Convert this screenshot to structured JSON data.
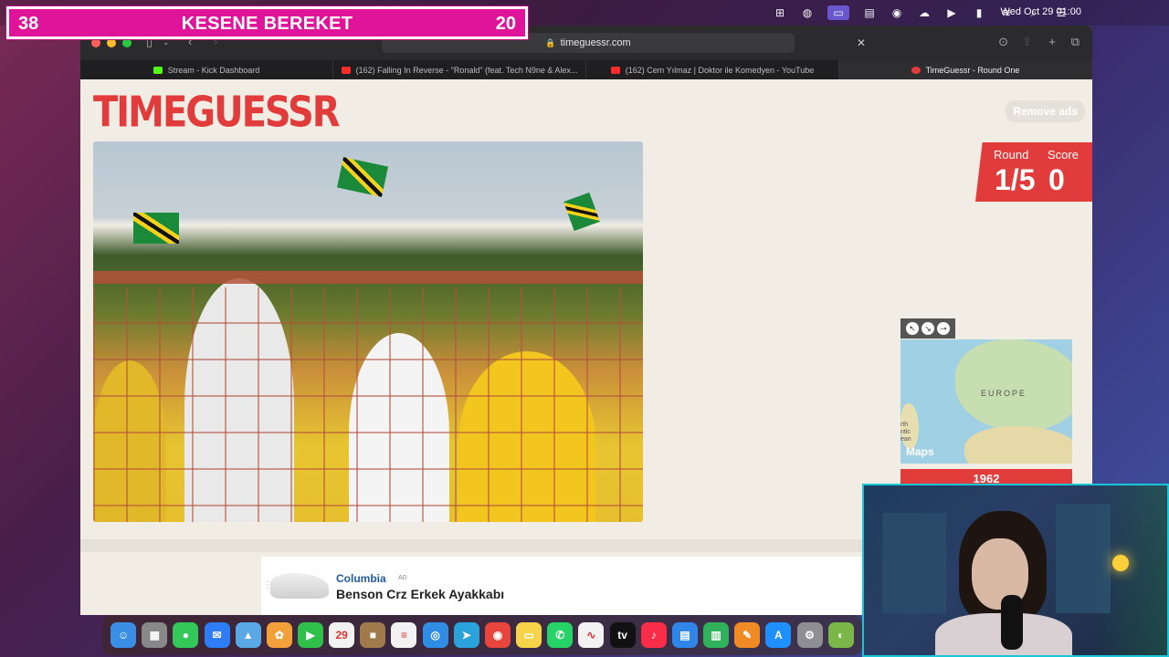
{
  "menubar": {
    "datetime": "Wed Oct 29  01:00",
    "icons": [
      "grid-icon",
      "swirl-icon",
      "screen-mirror-icon",
      "cc-icon",
      "eye-icon",
      "cloud-icon",
      "play-icon",
      "battery-icon",
      "wifi-icon",
      "search-icon",
      "control-center-icon"
    ]
  },
  "overlay": {
    "left_number": "38",
    "title": "KESENE BEREKET",
    "right_number": "20",
    "color": "#e0149b"
  },
  "browser": {
    "url": "timeguessr.com",
    "tabs": [
      {
        "label": "Stream - Kick Dashboard",
        "color": "#53fc18"
      },
      {
        "label": "(162) Falling In Reverse - \"Ronald\" (feat. Tech N9ne & Alex...",
        "color": "#ff2a2a"
      },
      {
        "label": "(162) Cem Yılmaz | Doktor ile Komedyen - YouTube",
        "color": "#ff2a2a"
      },
      {
        "label": "TimeGuessr - Round One",
        "color": "#e23b3b"
      }
    ]
  },
  "page": {
    "logo": "TIMEGUESSR",
    "remove_ads": "Remove ads",
    "round_label": "Round",
    "score_label": "Score",
    "round_value": "1/5",
    "score_value": "0",
    "accent": "#e23b3b"
  },
  "map": {
    "region_label": "EUROPE",
    "maps_brand": "Maps",
    "edge_text": "rth\nntic\nean",
    "guess_year": "1962"
  },
  "ad": {
    "brand": "Columbia",
    "ad_tag": "AD",
    "product": "Benson Crz Erkek Ayakkabı"
  },
  "dock": {
    "apps": [
      {
        "name": "finder-icon",
        "glyph": "☺",
        "color": "#3a8ee6"
      },
      {
        "name": "launchpad-icon",
        "glyph": "▦",
        "color": "#888"
      },
      {
        "name": "messages-icon",
        "glyph": "●",
        "color": "#34c759"
      },
      {
        "name": "mail-icon",
        "glyph": "✉",
        "color": "#2e7cf6"
      },
      {
        "name": "maps-icon",
        "glyph": "▲",
        "color": "#5aa9e6"
      },
      {
        "name": "photos-icon",
        "glyph": "✿",
        "color": "#f4a03a"
      },
      {
        "name": "facetime-icon",
        "glyph": "▶",
        "color": "#2fbf4a"
      },
      {
        "name": "calendar-icon",
        "glyph": "29",
        "color": "#f2f2f2"
      },
      {
        "name": "notes-brown-icon",
        "glyph": "■",
        "color": "#a07a4a"
      },
      {
        "name": "reminders-icon",
        "glyph": "≡",
        "color": "#f2f2f2"
      },
      {
        "name": "safari-icon",
        "glyph": "◎",
        "color": "#2f8de6"
      },
      {
        "name": "telegram-icon",
        "glyph": "➤",
        "color": "#2aa3dd"
      },
      {
        "name": "chrome-icon",
        "glyph": "◉",
        "color": "#e8453c"
      },
      {
        "name": "notes-icon",
        "glyph": "▭",
        "color": "#f7d34a"
      },
      {
        "name": "whatsapp-icon",
        "glyph": "✆",
        "color": "#25d366"
      },
      {
        "name": "freeform-icon",
        "glyph": "∿",
        "color": "#f2f2f2"
      },
      {
        "name": "tv-icon",
        "glyph": "tv",
        "color": "#111"
      },
      {
        "name": "music-icon",
        "glyph": "♪",
        "color": "#fa2d48"
      },
      {
        "name": "keynote-icon",
        "glyph": "▤",
        "color": "#2f86e8"
      },
      {
        "name": "numbers-icon",
        "glyph": "▥",
        "color": "#31b15a"
      },
      {
        "name": "pages-icon",
        "glyph": "✎",
        "color": "#f08a24"
      },
      {
        "name": "app-store-icon",
        "glyph": "A",
        "color": "#1e90ff"
      },
      {
        "name": "settings-icon",
        "glyph": "⚙",
        "color": "#8e8e93"
      },
      {
        "name": "globe-app-icon",
        "glyph": "◐",
        "color": "#7ab648"
      }
    ]
  }
}
